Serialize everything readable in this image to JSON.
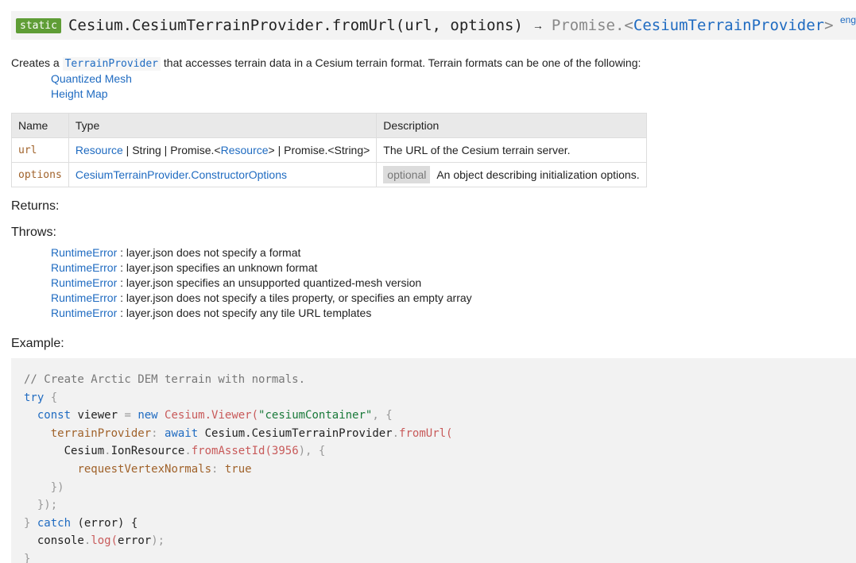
{
  "signature": {
    "badge": "static",
    "name": "Cesium.CesiumTerrainProvider.fromUrl(url, options)",
    "arrow": "→",
    "return_prefix": "Promise.<",
    "return_type": "CesiumTerrainProvider",
    "return_suffix": ">",
    "lang_link": "eng"
  },
  "description": {
    "before": "Creates a ",
    "link": "TerrainProvider",
    "after": " that accesses terrain data in a Cesium terrain format. Terrain formats can be one of the following:",
    "formats": [
      "Quantized Mesh",
      "Height Map"
    ]
  },
  "params_table": {
    "headers": [
      "Name",
      "Type",
      "Description"
    ],
    "rows": [
      {
        "name": "url",
        "type_parts": [
          "Resource",
          " | String | Promise.<",
          "Resource",
          "> | Promise.<String>"
        ],
        "optional": "",
        "description": "The URL of the Cesium terrain server."
      },
      {
        "name": "options",
        "type_parts": [
          "CesiumTerrainProvider.ConstructorOptions"
        ],
        "optional": "optional",
        "description": "An object describing initialization options."
      }
    ]
  },
  "returns_label": "Returns:",
  "throws_label": "Throws:",
  "throws": [
    {
      "type": "RuntimeError",
      "sep": " : ",
      "text": "layer.json does not specify a format"
    },
    {
      "type": "RuntimeError",
      "sep": " : ",
      "text": "layer.json specifies an unknown format"
    },
    {
      "type": "RuntimeError",
      "sep": " : ",
      "text": "layer.json specifies an unsupported quantized-mesh version"
    },
    {
      "type": "RuntimeError",
      "sep": " : ",
      "text": "layer.json does not specify a tiles property, or specifies an empty array"
    },
    {
      "type": "RuntimeError",
      "sep": " : ",
      "text": "layer.json does not specify any tile URL templates"
    }
  ],
  "example_label": "Example:",
  "example_code": {
    "l1": "// Create Arctic DEM terrain with normals.",
    "l2_kw": "try",
    "l2_rest": " {",
    "l3_kw": "const",
    "l3_var": " viewer ",
    "l3_eq": "=",
    "l3_new": " new",
    "l3_cls": " Cesium.Viewer(",
    "l3_str": "\"cesiumContainer\"",
    "l3_end": ", {",
    "l4_prop": "terrainProvider",
    "l4_colon": ":",
    "l4_await": " await",
    "l4_obj": " Cesium.CesiumTerrainProvider",
    "l4_dot": ".",
    "l4_fn": "fromUrl(",
    "l5_obj": "Cesium",
    "l5_dot": ".",
    "l5_cls": "IonResource",
    "l5_dot2": ".",
    "l5_fn": "fromAssetId(",
    "l5_num": "3956",
    "l5_end": "), {",
    "l6_prop": "requestVertexNormals",
    "l6_colon": ":",
    "l6_val": " true",
    "l7": "})",
    "l8": "});",
    "l9_brace": "}",
    "l9_kw": " catch",
    "l9_rest": " (error) {",
    "l10_obj": "console",
    "l10_dot": ".",
    "l10_fn": "log(",
    "l10_arg": "error",
    "l10_end": ");",
    "l11": "}"
  }
}
